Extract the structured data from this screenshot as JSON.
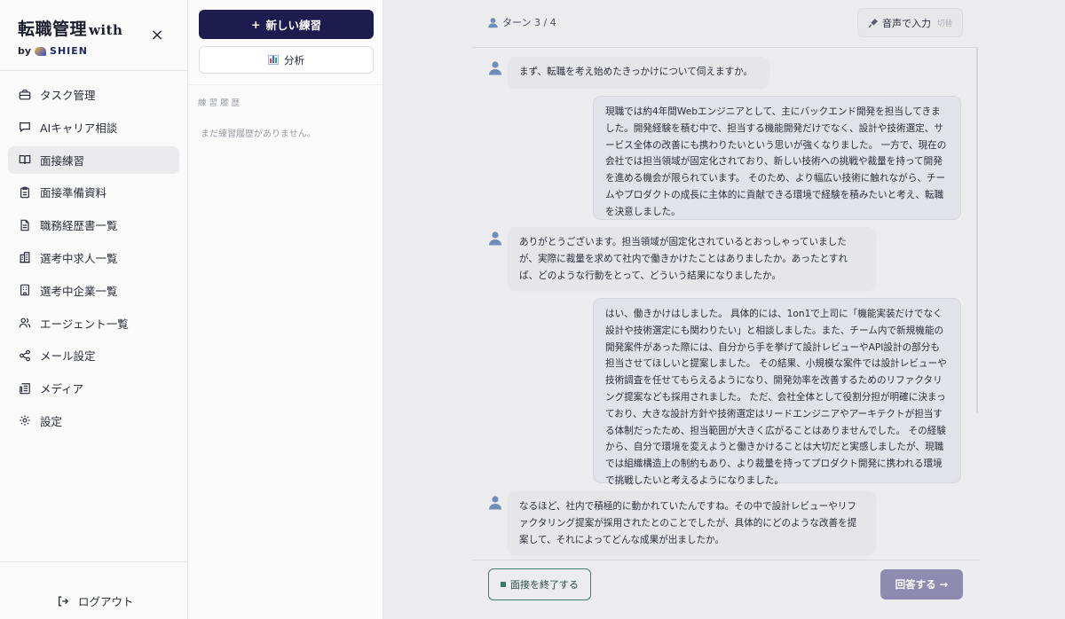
{
  "brand": {
    "title": "転職管理",
    "title_suffix": "with",
    "by": "by",
    "logo_text": "SHIEN",
    "close_glyph": "×"
  },
  "sidebar": {
    "items": [
      {
        "label": "タスク管理",
        "icon": "briefcase-icon",
        "active": false
      },
      {
        "label": "AIキャリア相談",
        "icon": "chat-bubble-icon",
        "active": false
      },
      {
        "label": "面接練習",
        "icon": "book-open-icon",
        "active": true
      },
      {
        "label": "面接準備資料",
        "icon": "clipboard-icon",
        "active": false
      },
      {
        "label": "職務経歴書一覧",
        "icon": "document-icon",
        "active": false
      },
      {
        "label": "選考中求人一覧",
        "icon": "building-icon",
        "active": false
      },
      {
        "label": "選考中企業一覧",
        "icon": "office-icon",
        "active": false
      },
      {
        "label": "エージェント一覧",
        "icon": "users-icon",
        "active": false
      },
      {
        "label": "メール設定",
        "icon": "share-icon",
        "active": false
      },
      {
        "label": "メディア",
        "icon": "newspaper-icon",
        "active": false
      },
      {
        "label": "設定",
        "icon": "gear-icon",
        "active": false
      }
    ],
    "logout_label": "ログアウト"
  },
  "practice": {
    "new_label": "新しい練習",
    "new_glyph": "+",
    "analysis_label": "分析",
    "history_title": "練習履歴",
    "history_empty": "まだ練習履歴がありません。"
  },
  "chat": {
    "turn_label": "ターン 3 / 4",
    "voice_label": "音声で入力",
    "voice_sub": "切替",
    "messages": [
      {
        "role": "q",
        "text": "まず、転職を考え始めたきっかけについて伺えますか。"
      },
      {
        "role": "a",
        "text": "現職では約4年間Webエンジニアとして、主にバックエンド開発を担当してきました。開発経験を積む中で、担当する機能開発だけでなく、設計や技術選定、サービス全体の改善にも携わりたいという思いが強くなりました。 一方で、現在の会社では担当領域が固定化されており、新しい技術への挑戦や裁量を持って開発を進める機会が限られています。 そのため、より幅広い技術に触れながら、チームやプロダクトの成長に主体的に貢献できる環境で経験を積みたいと考え、転職を決意しました。"
      },
      {
        "role": "q",
        "text": "ありがとうございます。担当領域が固定化されているとおっしゃっていましたが、実際に裁量を求めて社内で働きかけたことはありましたか。あったとすれば、どのような行動をとって、どういう結果になりましたか。"
      },
      {
        "role": "a",
        "text": "はい、働きかけはしました。 具体的には、1on1で上司に「機能実装だけでなく設計や技術選定にも関わりたい」と相談しました。また、チーム内で新規機能の開発案件があった際には、自分から手を挙げて設計レビューやAPI設計の部分も担当させてほしいと提案しました。 その結果、小規模な案件では設計レビューや技術調査を任せてもらえるようになり、開発効率を改善するためのリファクタリング提案なども採用されました。 ただ、会社全体として役割分担が明確に決まっており、大きな設計方針や技術選定はリードエンジニアやアーキテクトが担当する体制だったため、担当範囲が大きく広がることはありませんでした。 その経験から、自分で環境を変えようと働きかけることは大切だと実感しましたが、現職では組織構造上の制約もあり、より裁量を持ってプロダクト開発に携われる環境で挑戦したいと考えるようになりました。"
      },
      {
        "role": "q",
        "text": "なるほど、社内で積極的に動かれていたんですね。その中で設計レビューやリファクタリング提案が採用されたとのことでしたが、具体的にどのような改善を提案して、それによってどんな成果が出ましたか。"
      }
    ],
    "end_label": "面接を終了する",
    "answer_label": "回答する →"
  }
}
